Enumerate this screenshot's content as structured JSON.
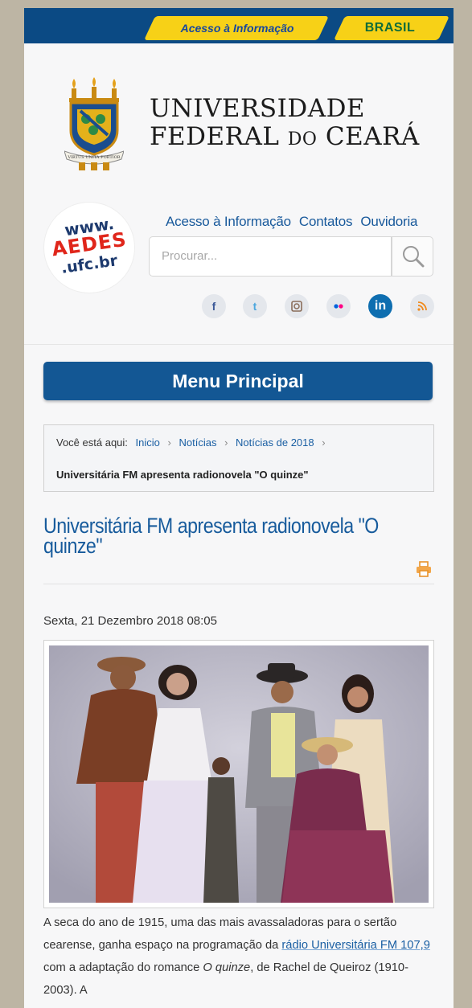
{
  "gov_bar": {
    "access_label": "Acesso à Informação",
    "brasil_label": "BRASIL",
    "bar_color": "#0b4a84",
    "badge_color": "#f7d117"
  },
  "header": {
    "uni_line1": "UNIVERSIDADE",
    "uni_line2_a": "FEDERAL",
    "uni_line2_b": "DO",
    "uni_line2_c": "CEARÁ",
    "crest_motto": "VIRTUS UNITA FORTIOR"
  },
  "aedes": {
    "line1": "www.",
    "line2": "AEDES",
    "line3": ".ufc.br"
  },
  "top_links": [
    "Acesso à Informação",
    "Contatos",
    "Ouvidoria"
  ],
  "search": {
    "placeholder": "Procurar..."
  },
  "social_icons": [
    "facebook-icon",
    "twitter-icon",
    "instagram-icon",
    "flickr-icon",
    "linkedin-icon",
    "rss-icon"
  ],
  "menu": {
    "label": "Menu Principal",
    "color": "#135794"
  },
  "breadcrumb": {
    "prefix": "Você está aqui:",
    "items": [
      "Inicio",
      "Notícias",
      "Notícias de 2018"
    ],
    "current": "Universitária FM apresenta radionovela \"O quinze\""
  },
  "article": {
    "title": "Universitária FM apresenta radionovela \"O quinze\"",
    "date": "Sexta, 21 Dezembro 2018 08:05",
    "body_1": "A seca do ano de 1915, uma das mais avassaladoras para o sertão cearense, ganha espaço na programação da ",
    "body_link": "rádio Universitária FM 107,9",
    "body_2": " com a adaptação do romance ",
    "body_italic": "O quinze",
    "body_3": ", de Rachel de Queiroz (1910-2003). A"
  }
}
